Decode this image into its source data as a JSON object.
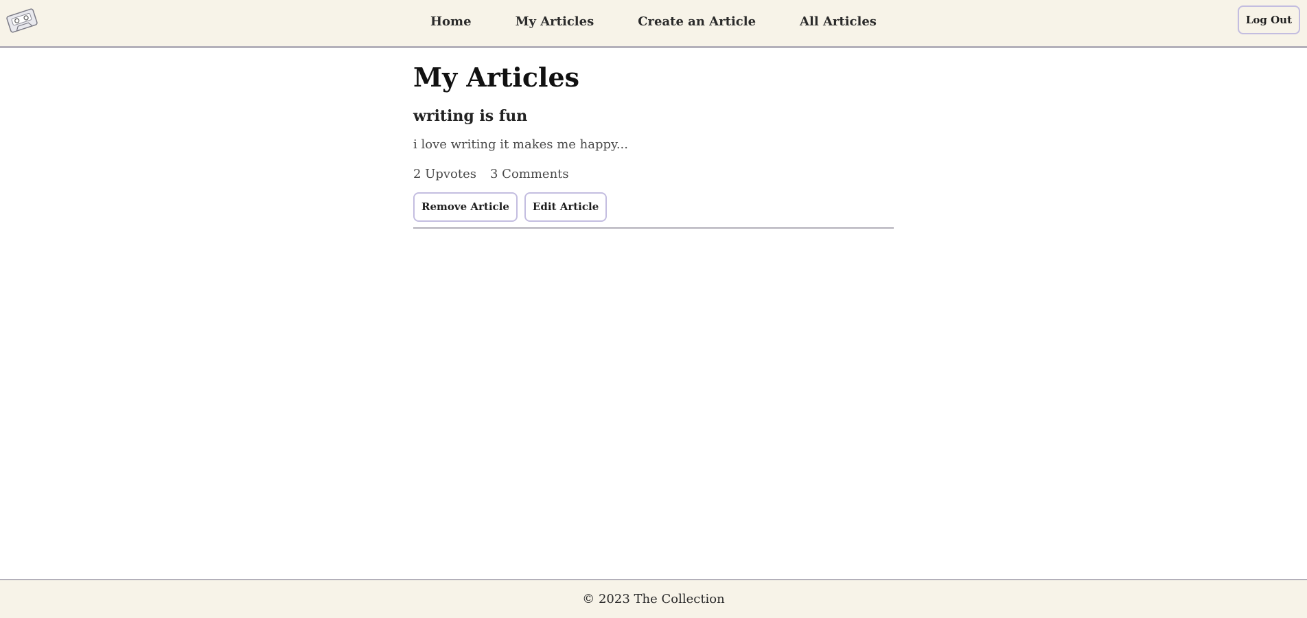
{
  "header": {
    "logo_icon": "cassette-tape-icon",
    "nav": [
      {
        "label": "Home"
      },
      {
        "label": "My Articles"
      },
      {
        "label": "Create an Article"
      },
      {
        "label": "All Articles"
      }
    ],
    "logout_label": "Log Out"
  },
  "main": {
    "title": "My Articles",
    "articles": [
      {
        "title": "writing is fun",
        "excerpt": "i love writing it makes me happy...",
        "upvotes_text": "2 Upvotes",
        "comments_text": "3 Comments",
        "remove_label": "Remove Article",
        "edit_label": "Edit Article"
      }
    ]
  },
  "footer": {
    "text": "© 2023 The Collection"
  },
  "colors": {
    "header_bg": "#f7f3e8",
    "border": "#b3b0ba",
    "button_border": "#c3bde0"
  }
}
